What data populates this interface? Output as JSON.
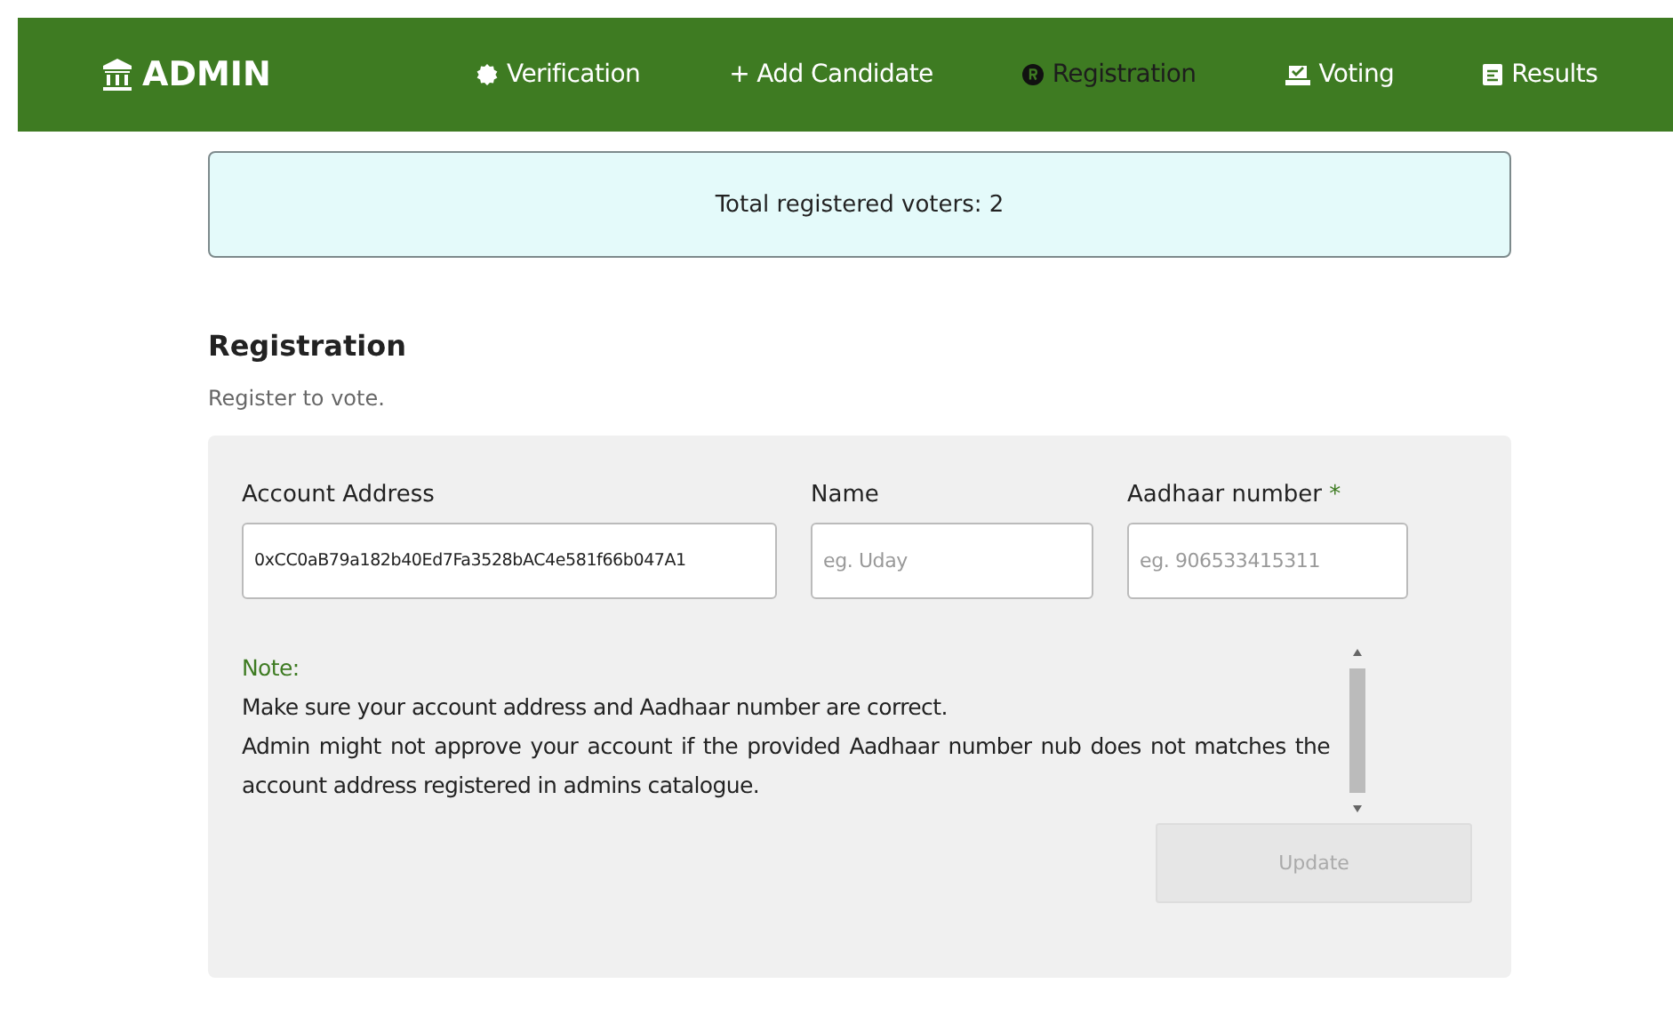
{
  "navbar": {
    "brand": "ADMIN",
    "items": [
      {
        "label": "Verification",
        "selected": false
      },
      {
        "label": "+ Add Candidate",
        "selected": false
      },
      {
        "label": "Registration",
        "selected": true
      },
      {
        "label": "Voting",
        "selected": false
      },
      {
        "label": "Results",
        "selected": false
      }
    ]
  },
  "banner": {
    "text": "Total registered voters: 2"
  },
  "section": {
    "title": "Registration",
    "subtitle": "Register to vote."
  },
  "form": {
    "fields": [
      {
        "label": "Account Address",
        "value": "0xCC0aB79a182b40Ed7Fa3528bAC4e581f66b047A1"
      },
      {
        "label": "Name",
        "placeholder": "eg. Uday"
      },
      {
        "label": "Aadhaar number",
        "required_mark": "*",
        "placeholder": "eg. 906533415311"
      }
    ],
    "note": {
      "title": "Note:",
      "lines": [
        "Make sure your account address and Aadhaar number are correct.",
        "Admin might not approve your account if the provided Aadhaar number nub does not matches the account address registered in admins catalogue."
      ]
    },
    "button": {
      "label": "Update",
      "disabled": true
    }
  }
}
